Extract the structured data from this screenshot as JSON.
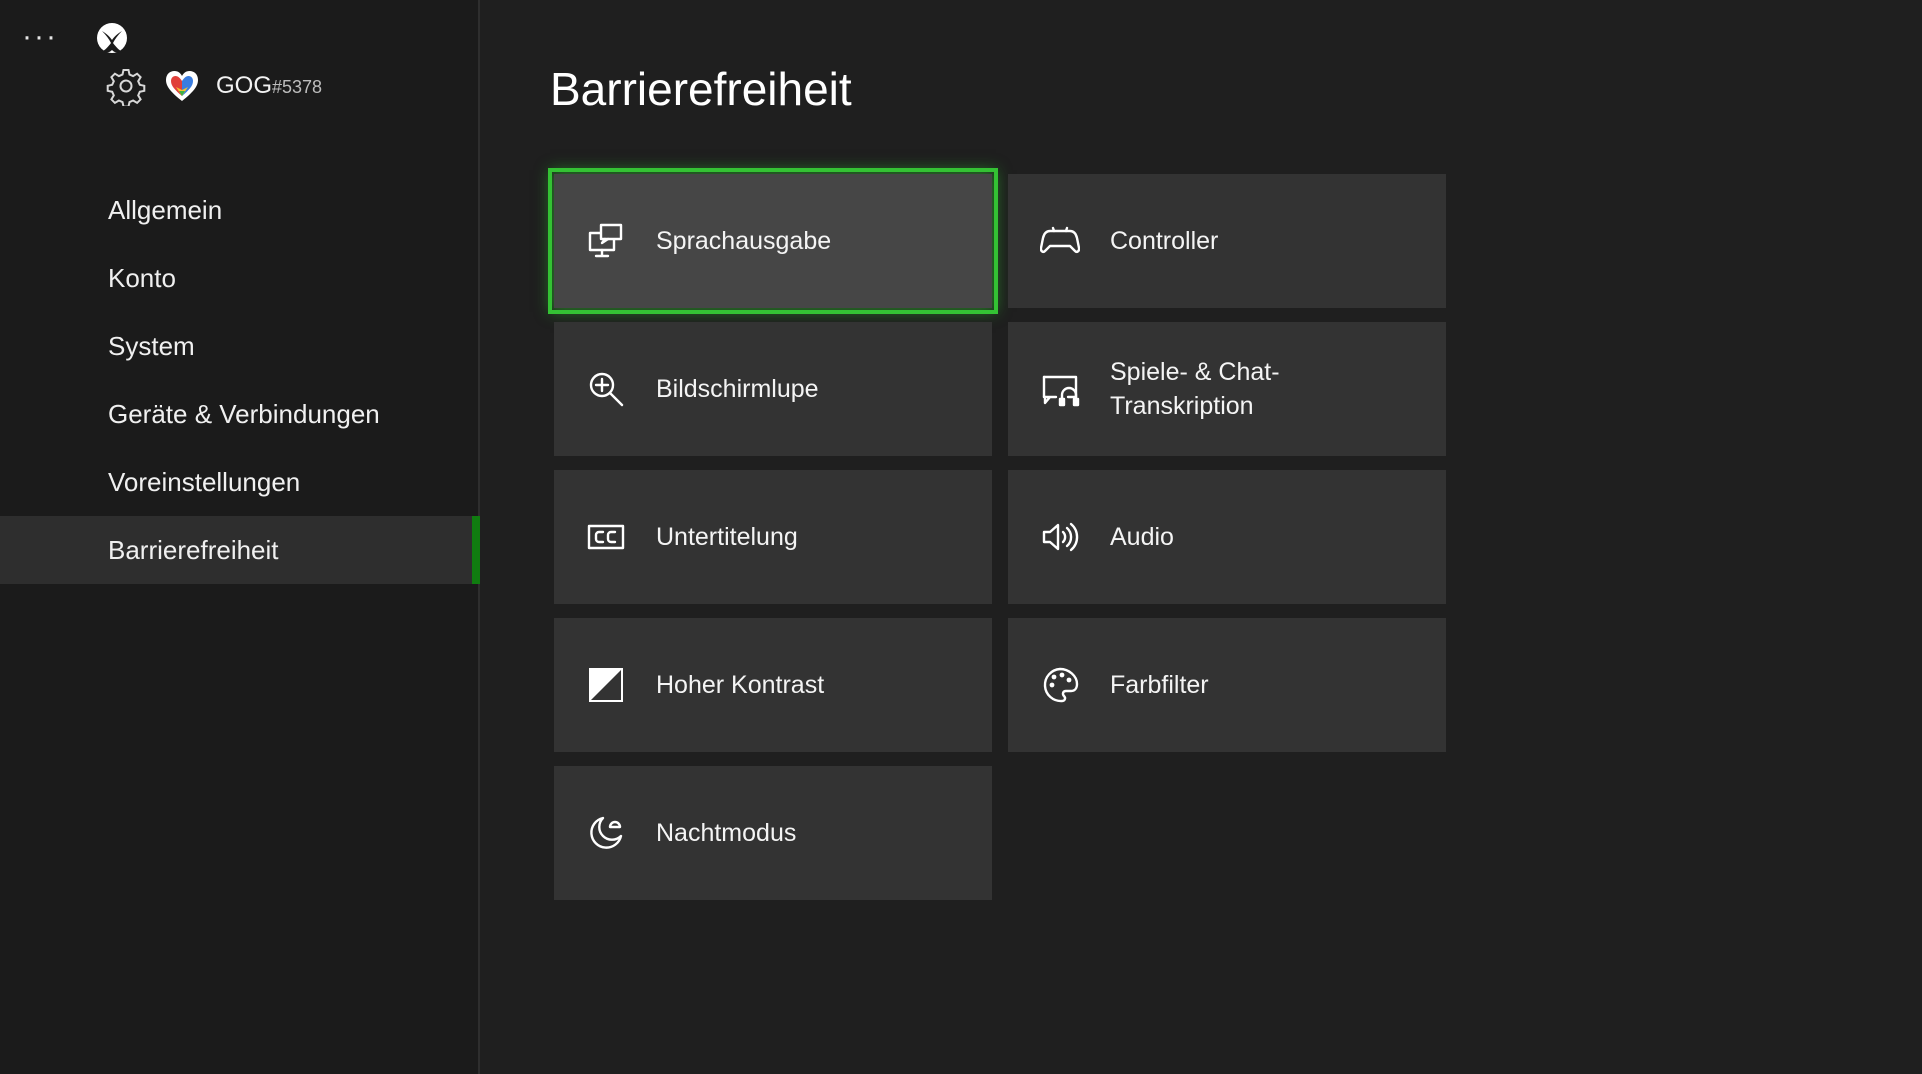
{
  "header": {
    "more_label": "···",
    "gamertag": "GOG",
    "gamertag_suffix": "#5378"
  },
  "sidebar": {
    "items": [
      {
        "label": "Allgemein"
      },
      {
        "label": "Konto"
      },
      {
        "label": "System"
      },
      {
        "label": "Geräte & Verbindungen"
      },
      {
        "label": "Voreinstellungen"
      },
      {
        "label": "Barrierefreiheit"
      }
    ],
    "active_index": 5
  },
  "main": {
    "title": "Barrierefreiheit",
    "tiles": [
      {
        "label": "Sprachausgabe",
        "icon": "narrator-icon"
      },
      {
        "label": "Controller",
        "icon": "controller-icon"
      },
      {
        "label": "Bildschirmlupe",
        "icon": "magnifier-icon"
      },
      {
        "label": "Spiele- & Chat-\nTranskription",
        "icon": "chat-transcription-icon"
      },
      {
        "label": "Untertitelung",
        "icon": "closed-captions-icon"
      },
      {
        "label": "Audio",
        "icon": "speaker-icon"
      },
      {
        "label": "Hoher Kontrast",
        "icon": "high-contrast-icon"
      },
      {
        "label": "Farbfilter",
        "icon": "color-palette-icon"
      },
      {
        "label": "Nachtmodus",
        "icon": "night-mode-icon"
      }
    ],
    "focused_index": 0
  },
  "colors": {
    "accent": "#107c10",
    "focus_outline": "#34c234",
    "background": "#1f1f1f",
    "tile": "#333333"
  }
}
